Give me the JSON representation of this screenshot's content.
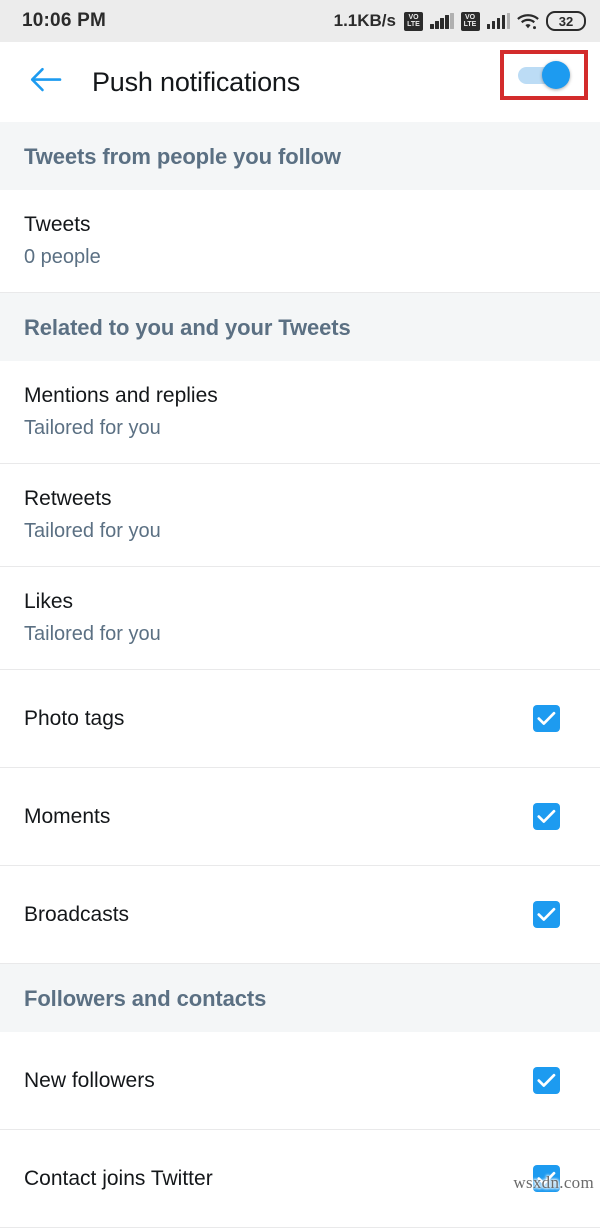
{
  "status_bar": {
    "time": "10:06 PM",
    "network_speed": "1.1KB/s",
    "volte_top": "VO",
    "volte_bottom": "LTE",
    "battery_level": "32",
    "icons": [
      "volte-icon",
      "signal-bars-icon",
      "volte-icon",
      "signal-bars-icon",
      "wifi-icon",
      "battery-icon"
    ]
  },
  "app_bar": {
    "back_icon": "arrow-left-icon",
    "title": "Push notifications",
    "toggle_on": true,
    "accent_color": "#1d9bf0",
    "highlight_color": "#d32b2b"
  },
  "sections": [
    {
      "header": "Tweets from people you follow",
      "rows": [
        {
          "title": "Tweets",
          "subtitle": "0 people",
          "type": "two-line"
        }
      ]
    },
    {
      "header": "Related to you and your Tweets",
      "rows": [
        {
          "title": "Mentions and replies",
          "subtitle": "Tailored for you",
          "type": "two-line"
        },
        {
          "title": "Retweets",
          "subtitle": "Tailored for you",
          "type": "two-line"
        },
        {
          "title": "Likes",
          "subtitle": "Tailored for you",
          "type": "two-line"
        },
        {
          "title": "Photo tags",
          "checked": true,
          "type": "checkbox"
        },
        {
          "title": "Moments",
          "checked": true,
          "type": "checkbox"
        },
        {
          "title": "Broadcasts",
          "checked": true,
          "type": "checkbox"
        }
      ]
    },
    {
      "header": "Followers and contacts",
      "rows": [
        {
          "title": "New followers",
          "checked": true,
          "type": "checkbox"
        },
        {
          "title": "Contact joins Twitter",
          "checked": true,
          "type": "checkbox"
        }
      ]
    }
  ],
  "watermark": "wsxdn.com"
}
